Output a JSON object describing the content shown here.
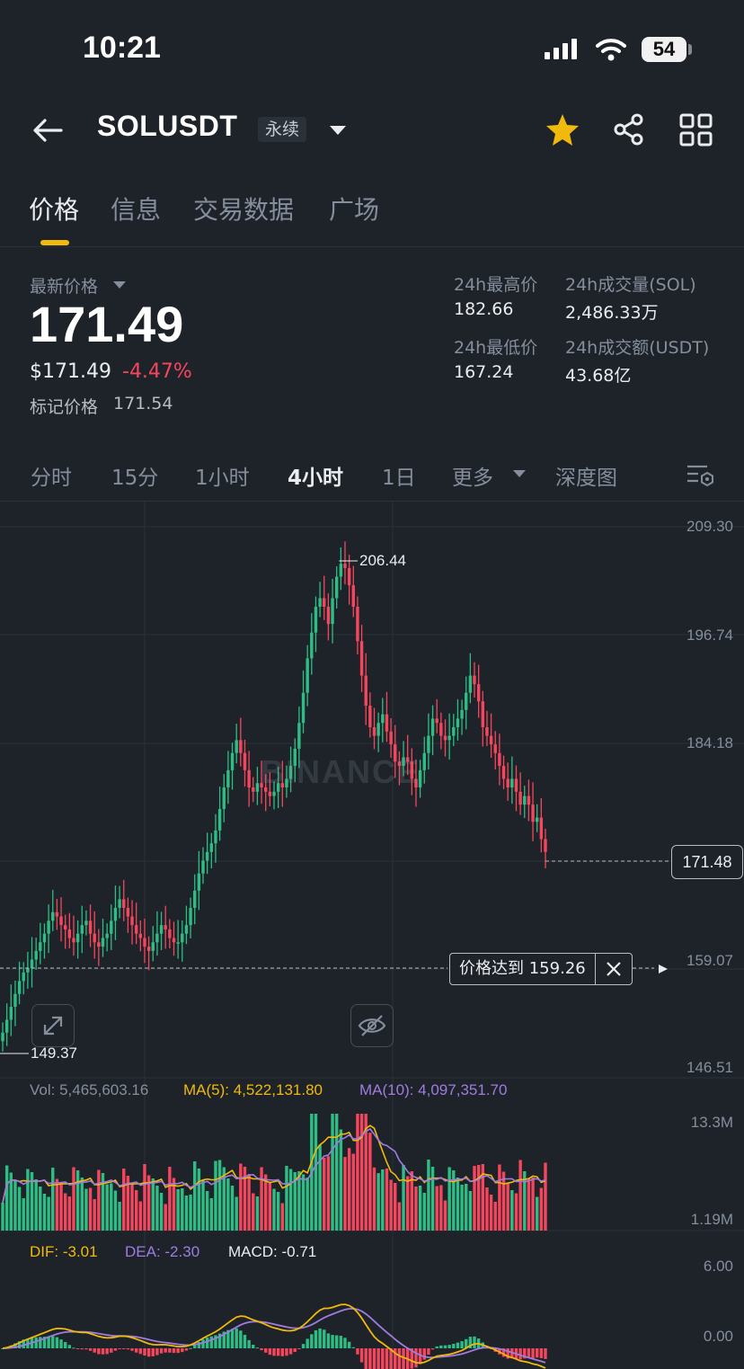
{
  "status_bar": {
    "time": "10:21",
    "battery": "54"
  },
  "header": {
    "symbol": "SOLUSDT",
    "contract_type": "永续"
  },
  "tabs": [
    {
      "label": "价格",
      "active": true
    },
    {
      "label": "信息",
      "active": false
    },
    {
      "label": "交易数据",
      "active": false
    },
    {
      "label": "广场",
      "active": false
    }
  ],
  "ticker": {
    "last_price_label": "最新价格",
    "last_price": "171.49",
    "usd_price": "$171.49",
    "change_pct": "-4.47%",
    "mark_price_label": "标记价格",
    "mark_price": "171.54",
    "high_label": "24h最高价",
    "high": "182.66",
    "low_label": "24h最低价",
    "low": "167.24",
    "vol_base_label": "24h成交量(SOL)",
    "vol_base": "2,486.33万",
    "vol_quote_label": "24h成交额(USDT)",
    "vol_quote": "43.68亿"
  },
  "timeframes": [
    "分时",
    "15分",
    "1小时",
    "4小时",
    "1日"
  ],
  "timeframe_active": "4小时",
  "more_label": "更多",
  "depth_label": "深度图",
  "colors": {
    "up": "#2ebd85",
    "down": "#f6465d",
    "accent": "#f0b90b",
    "ma5": "#f0b90b",
    "ma10": "#9e7ce0",
    "bg": "#1e2329"
  },
  "price_axis": [
    "209.30",
    "196.74",
    "184.18",
    "171.48",
    "159.07",
    "146.51"
  ],
  "max_marker": "206.44",
  "min_marker": "149.37",
  "current_price_tag": "171.48",
  "alert": {
    "label": "价格达到",
    "value": "159.26"
  },
  "watermark": "BINANCE",
  "volume": {
    "vol_label": "Vol: 5,465,603.16",
    "ma5_label": "MA(5): 4,522,131.80",
    "ma10_label": "MA(10): 4,097,351.70",
    "axis_top": "13.3M",
    "axis_bottom": "1.19M"
  },
  "macd": {
    "dif_label": "DIF: -3.01",
    "dea_label": "DEA: -2.30",
    "macd_label": "MACD: -0.71",
    "axis_top": "6.00",
    "axis_bottom": "0.00"
  },
  "chart_data": {
    "type": "candlestick",
    "interval": "4h",
    "ohlc_approx_close": [
      150.5,
      152,
      153.5,
      155,
      156.5,
      157.5,
      158,
      159,
      160,
      161,
      162,
      163.5,
      164.5,
      164,
      163,
      162.5,
      161.5,
      161,
      162,
      163,
      163.5,
      162,
      161,
      160.5,
      161.5,
      162,
      163.5,
      165,
      166,
      165,
      164,
      163,
      162,
      161.5,
      160.5,
      160,
      161,
      162,
      163,
      162.5,
      161.5,
      161,
      161,
      162,
      163,
      165,
      167,
      169,
      170.5,
      171.5,
      172.5,
      174,
      176.5,
      179,
      181,
      183,
      184.5,
      183,
      181,
      179,
      178.5,
      179.5,
      179,
      178.5,
      178,
      178.5,
      179.5,
      179,
      180,
      181.5,
      183.5,
      186.5,
      190,
      194,
      197,
      200,
      201,
      200,
      198,
      201,
      203.5,
      205,
      204.5,
      202.5,
      200,
      196,
      192,
      188.5,
      186,
      185,
      186.5,
      187.5,
      185.5,
      184,
      182,
      181.5,
      182.5,
      182,
      180,
      179,
      181,
      183,
      185,
      187,
      186.5,
      185,
      184.5,
      185,
      186,
      187,
      188,
      190,
      192,
      191,
      189,
      186,
      185,
      184,
      183,
      181.5,
      180,
      179,
      180,
      178.5,
      177,
      178,
      177,
      175,
      175.5,
      173,
      171.5
    ],
    "max_price": 206.44,
    "min_price": 149.37,
    "y_range": [
      146.51,
      209.3
    ]
  }
}
